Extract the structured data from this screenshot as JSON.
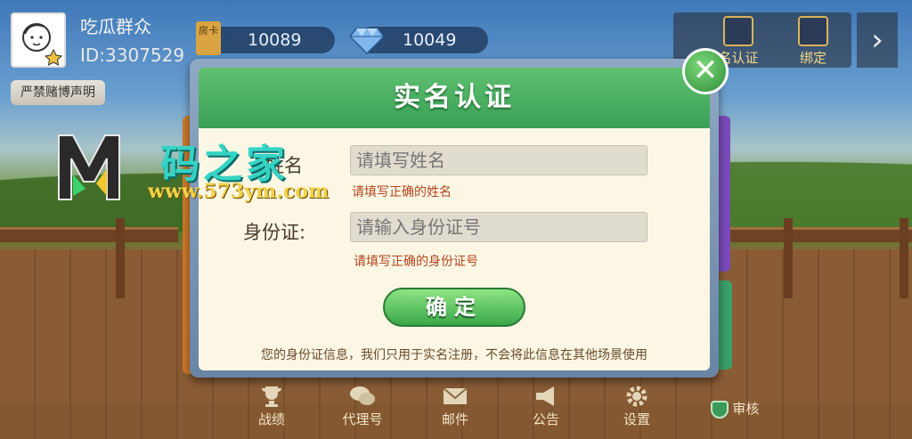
{
  "player": {
    "nickname": "吃瓜群众",
    "id_label": "ID:3307529",
    "ban_label": "严禁赌博声明"
  },
  "resources": {
    "card_icon_text": "房卡",
    "card_count": "10089",
    "gem_count": "10049"
  },
  "top_right": {
    "realname_label": "名认证",
    "bind_label": "绑定"
  },
  "watermark": {
    "site_name": "码之家",
    "url": "www.573ym.com"
  },
  "dialog": {
    "title": "实名认证",
    "name_label": "姓名",
    "name_placeholder": "请填写姓名",
    "name_hint": "请填写正确的姓名",
    "id_label": "身份证:",
    "id_placeholder": "请输入身份证号",
    "id_hint": "请填写正确的身份证号",
    "confirm_label": "确定",
    "notice": "您的身份证信息，我们只用于实名注册，不会将此信息在其他场景使用",
    "close_symbol": "✕"
  },
  "bottom_nav": [
    {
      "label": "战绩"
    },
    {
      "label": "代理号"
    },
    {
      "label": "邮件"
    },
    {
      "label": "公告"
    },
    {
      "label": "设置"
    },
    {
      "label": "审核"
    }
  ],
  "colors": {
    "dialog_header": "#3aa056",
    "hint_text": "#b4441e",
    "confirm_button": "#3aa84a"
  }
}
